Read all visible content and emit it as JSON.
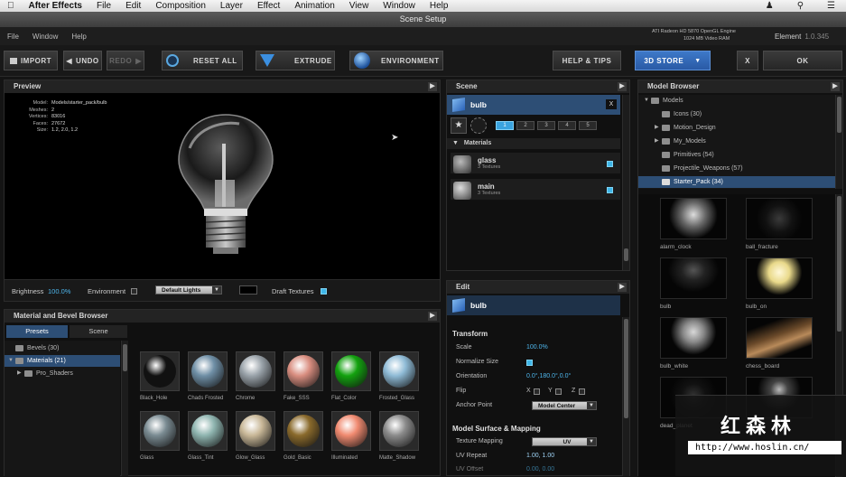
{
  "menubar": {
    "app_name": "After Effects",
    "items": [
      "File",
      "Edit",
      "Composition",
      "Layer",
      "Effect",
      "Animation",
      "View",
      "Window",
      "Help"
    ]
  },
  "window": {
    "title": "Scene Setup"
  },
  "plugin_menu": {
    "items": [
      "File",
      "Window",
      "Help"
    ],
    "gpu_line1": "ATI Radeon HD 5870 OpenGL Engine",
    "gpu_line2": "1024 MB Video RAM",
    "element_label": "Element",
    "element_version": "1.0.345"
  },
  "toolbar": {
    "import": "IMPORT",
    "undo": "UNDO",
    "redo": "REDO",
    "reset_all": "RESET ALL",
    "extrude": "EXTRUDE",
    "environment": "ENVIRONMENT",
    "help_tips": "HELP & TIPS",
    "store": "3D STORE",
    "close": "X",
    "ok": "OK"
  },
  "preview": {
    "title": "Preview",
    "info": [
      {
        "k": "Model:",
        "v": "Models/starter_pack/bulb"
      },
      {
        "k": "Meshes:",
        "v": "2"
      },
      {
        "k": "Vertices:",
        "v": "83016"
      },
      {
        "k": "Faces:",
        "v": "27672"
      },
      {
        "k": "Size:",
        "v": "1.2, 2.0, 1.2"
      }
    ],
    "brightness_label": "Brightness",
    "brightness_value": "100.0%",
    "environment_label": "Environment",
    "lights_value": "Default Lights",
    "draft_label": "Draft Textures"
  },
  "scene": {
    "title": "Scene",
    "object_name": "bulb",
    "close": "X",
    "groups": [
      "1",
      "2",
      "3",
      "4",
      "5"
    ],
    "materials_header": "Materials",
    "materials": [
      {
        "name": "glass",
        "sub": "3 Textures"
      },
      {
        "name": "main",
        "sub": "3 Textures"
      }
    ]
  },
  "edit": {
    "title": "Edit",
    "object_name": "bulb",
    "transform_header": "Transform",
    "scale_label": "Scale",
    "scale_value": "100.0%",
    "normalize_label": "Normalize Size",
    "orientation_label": "Orientation",
    "orientation_value": "0.0°,180.0°,0.0°",
    "flip_label": "Flip",
    "flip_x": "X",
    "flip_y": "Y",
    "flip_z": "Z",
    "anchor_label": "Anchor Point",
    "anchor_value": "Model Center",
    "surface_header": "Model Surface & Mapping",
    "texture_mapping_label": "Texture Mapping",
    "texture_mapping_value": "UV",
    "uv_repeat_label": "UV Repeat",
    "uv_repeat_value": "1.00, 1.00",
    "uv_offset_label": "UV Offset",
    "uv_offset_value": "0.00, 0.00"
  },
  "material_browser": {
    "title": "Material and Bevel Browser",
    "tab_presets": "Presets",
    "tab_scene": "Scene",
    "tree": [
      {
        "label": "Bevels (30)"
      },
      {
        "label": "Materials (21)"
      },
      {
        "label": "Pro_Shaders"
      }
    ],
    "materials": [
      {
        "label": "Black_Hole",
        "color": "#111"
      },
      {
        "label": "Chads Frosted",
        "color": "#6f8fa6"
      },
      {
        "label": "Chrome",
        "color": "#9aa3aa"
      },
      {
        "label": "Fake_SSS",
        "color": "#d98e80"
      },
      {
        "label": "Flat_Color",
        "color": "#13a20f"
      },
      {
        "label": "Frosted_Glass",
        "color": "#8fbbd6"
      },
      {
        "label": "Glass",
        "color": "#7a8b92"
      },
      {
        "label": "Glass_Tint",
        "color": "#8fb5b0"
      },
      {
        "label": "Glow_Glass",
        "color": "#c9b898"
      },
      {
        "label": "Gold_Basic",
        "color": "#8a6a2c"
      },
      {
        "label": "Illuminated",
        "color": "#f08a70"
      },
      {
        "label": "Matte_Shadow",
        "color": "#8c8c8c"
      }
    ]
  },
  "model_browser": {
    "title": "Model Browser",
    "tree": [
      {
        "label": "Models"
      },
      {
        "label": "Icons (30)"
      },
      {
        "label": "Motion_Design"
      },
      {
        "label": "My_Models"
      },
      {
        "label": "Primitives (54)"
      },
      {
        "label": "Projectile_Weapons (57)"
      },
      {
        "label": "Starter_Pack (34)"
      }
    ],
    "models": [
      {
        "label": "alarm_clock"
      },
      {
        "label": "ball_fracture"
      },
      {
        "label": "bulb"
      },
      {
        "label": "bulb_on"
      },
      {
        "label": "bulb_white"
      },
      {
        "label": "chess_board"
      },
      {
        "label": "dead_planet"
      },
      {
        "label": ""
      }
    ]
  },
  "watermark": {
    "cn": "红森林",
    "url": "http://www.hoslin.cn/"
  }
}
